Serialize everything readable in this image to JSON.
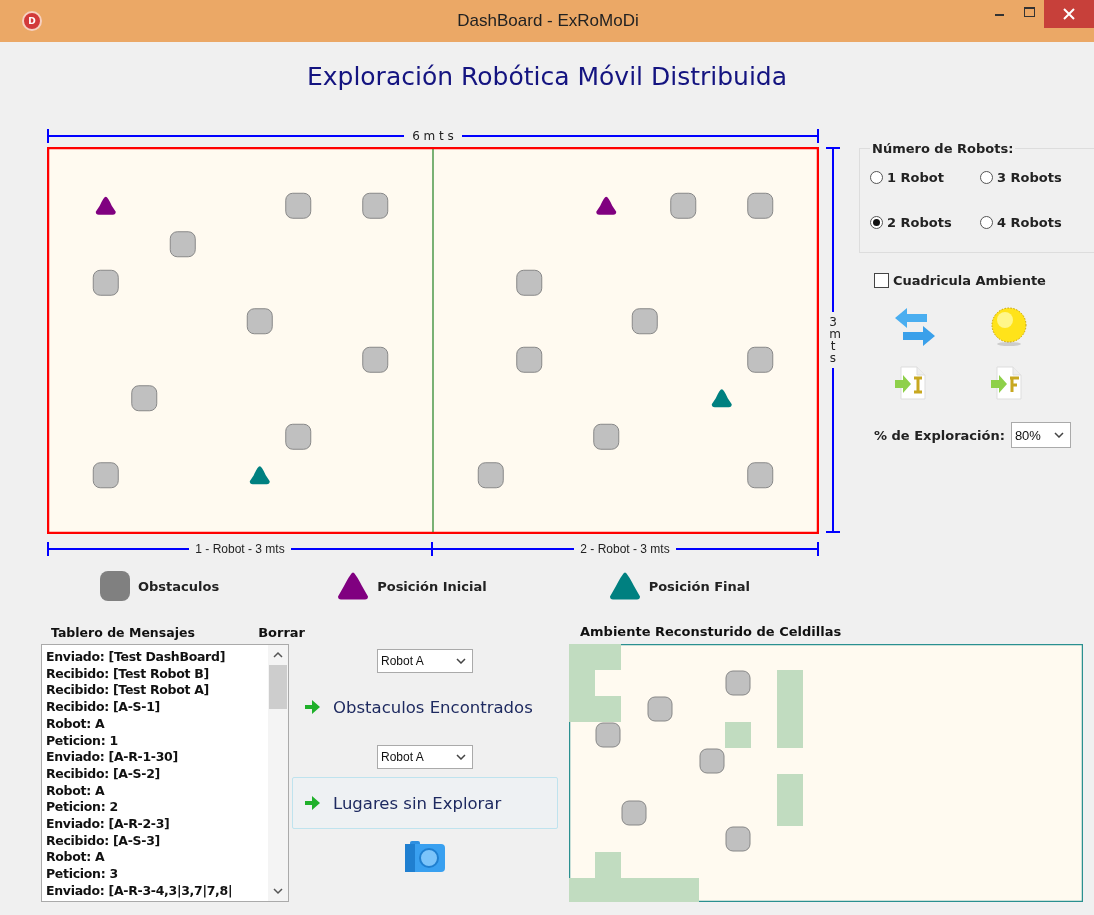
{
  "window": {
    "title": "DashBoard - ExRoMoDi",
    "icon_letter": "D"
  },
  "heading": "Exploración Robótica Móvil Distribuida",
  "map": {
    "width_label": "6 m t s",
    "height_label": "3mts",
    "sections": [
      {
        "label": "1 - Robot - 3 mts"
      },
      {
        "label": "2 - Robot - 3 mts"
      }
    ],
    "items": [
      {
        "kind": "start"
      },
      {
        "kind": "obstacle"
      },
      {
        "kind": "obstacle"
      },
      {
        "kind": "obstacle"
      },
      {
        "kind": "obstacle"
      },
      {
        "kind": "obstacle"
      },
      {
        "kind": "obstacle"
      },
      {
        "kind": "obstacle"
      },
      {
        "kind": "obstacle"
      },
      {
        "kind": "obstacle"
      },
      {
        "kind": "goal"
      },
      {
        "kind": "start"
      },
      {
        "kind": "obstacle"
      },
      {
        "kind": "obstacle"
      },
      {
        "kind": "obstacle"
      },
      {
        "kind": "obstacle"
      },
      {
        "kind": "obstacle"
      },
      {
        "kind": "obstacle"
      },
      {
        "kind": "goal"
      },
      {
        "kind": "obstacle"
      },
      {
        "kind": "obstacle"
      },
      {
        "kind": "obstacle"
      }
    ]
  },
  "legend": [
    {
      "kind": "obstacle",
      "label": "Obstaculos"
    },
    {
      "kind": "start",
      "label": "Posición Inicial"
    },
    {
      "kind": "goal",
      "label": "Posición Final"
    }
  ],
  "robots_group": {
    "title": "Número de Robots:",
    "options": [
      {
        "label": "1 Robot",
        "selected": false
      },
      {
        "label": "3 Robots",
        "selected": false
      },
      {
        "label": "2 Robots",
        "selected": true
      },
      {
        "label": "4 Robots",
        "selected": false
      }
    ]
  },
  "grid_checkbox": {
    "label": "Cuadricula Ambiente",
    "checked": false
  },
  "exploration": {
    "label": "% de Exploración:",
    "value": "80%"
  },
  "messages": {
    "title": "Tablero de Mensajes",
    "clear_label": "Borrar",
    "lines": [
      "Enviado: [Test DashBoard]",
      "Recibido: [Test Robot B]",
      "Recibido: [Test Robot A]",
      "Recibido: [A-S-1]",
      "Robot: A",
      "Peticion: 1",
      "Enviado: [A-R-1-30]",
      "Recibido: [A-S-2]",
      "Robot: A",
      "Peticion: 2",
      "Enviado: [A-R-2-3]",
      "Recibido: [A-S-3]",
      "Robot: A",
      "Peticion: 3",
      "Enviado: [A-R-3-4,3|3,7|7,8|"
    ]
  },
  "actions": [
    {
      "robot": "Robot A",
      "label": "Obstaculos Encontrados",
      "focused": false
    },
    {
      "robot": "Robot A",
      "label": "Lugares sin Explorar",
      "focused": true
    }
  ],
  "reconstruction": {
    "title": "Ambiente Reconsturido de Celdillas",
    "cells": [
      {
        "kind": "explored"
      },
      {
        "kind": "explored"
      },
      {
        "kind": "explored"
      },
      {
        "kind": "explored"
      },
      {
        "kind": "explored"
      },
      {
        "kind": "explored"
      },
      {
        "kind": "explored"
      },
      {
        "kind": "explored"
      },
      {
        "kind": "explored"
      },
      {
        "kind": "explored"
      },
      {
        "kind": "explored"
      },
      {
        "kind": "explored"
      },
      {
        "kind": "explored"
      },
      {
        "kind": "explored"
      },
      {
        "kind": "explored"
      },
      {
        "kind": "explored"
      },
      {
        "kind": "explored"
      },
      {
        "kind": "obstacle"
      },
      {
        "kind": "obstacle"
      },
      {
        "kind": "obstacle"
      },
      {
        "kind": "obstacle"
      },
      {
        "kind": "obstacle"
      },
      {
        "kind": "obstacle"
      }
    ]
  }
}
